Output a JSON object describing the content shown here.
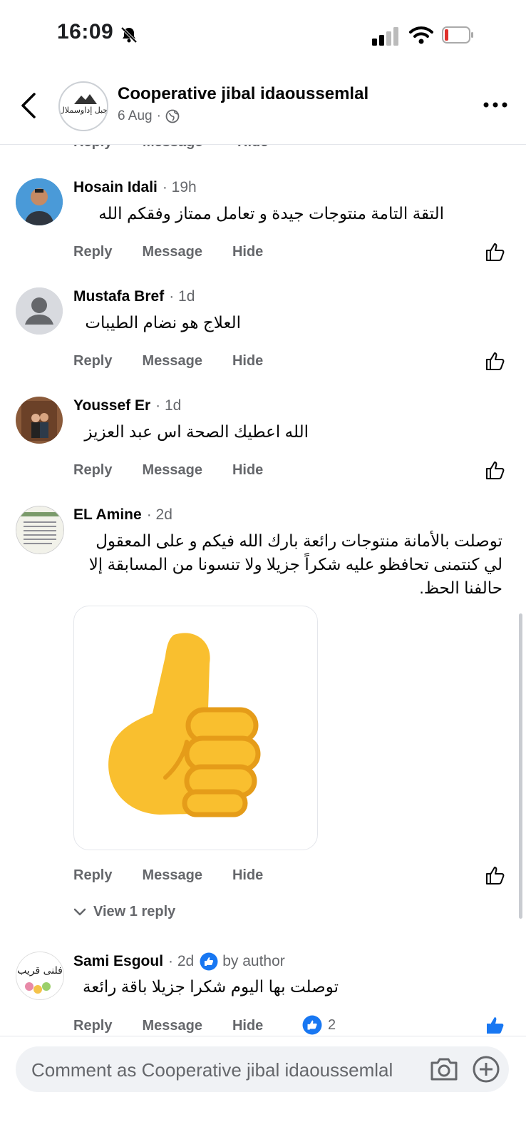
{
  "status_bar": {
    "time": "16:09"
  },
  "header": {
    "page_name": "Cooperative jibal idaoussemlal",
    "date": "6 Aug",
    "separator": "·",
    "logo_text": "جبل إداوسملال"
  },
  "actions": {
    "reply": "Reply",
    "message": "Message",
    "hide": "Hide"
  },
  "comments": [
    {
      "name": "Hosain Idali",
      "time": "· 19h",
      "text": "التقة التامة منتوجات جيدة و تعامل ممتاز وفقكم الله"
    },
    {
      "name": "Mustafa Bref",
      "time": "· 1d",
      "text": "العلاج هو نضام الطيبات"
    },
    {
      "name": "Youssef Er",
      "time": "· 1d",
      "text": "الله اعطيك الصحة اس عبد العزيز"
    },
    {
      "name": "EL Amine",
      "time": "· 2d",
      "text": "توصلت بالأمانة منتوجات رائعة بارك الله فيكم و على المعقول لي كنتمنى تحافظو عليه شكراً جزيلا ولا تنسونا من المسابقة إلا حالفنا الحظ.",
      "view_replies": "View 1 reply"
    },
    {
      "name": "Sami Esgoul",
      "time": "· 2d",
      "by_author": "by author",
      "text": "توصلت بها اليوم شكرا جزيلا باقة رائعة",
      "reaction_count": "2",
      "avatar_text": "فلنی قریب"
    }
  ],
  "composer": {
    "placeholder": "Comment as Cooperative jibal idaoussemlal"
  },
  "colors": {
    "accent": "#1877f2",
    "secondary_text": "#65676b",
    "sticker_yellow": "#f9bf2f"
  }
}
